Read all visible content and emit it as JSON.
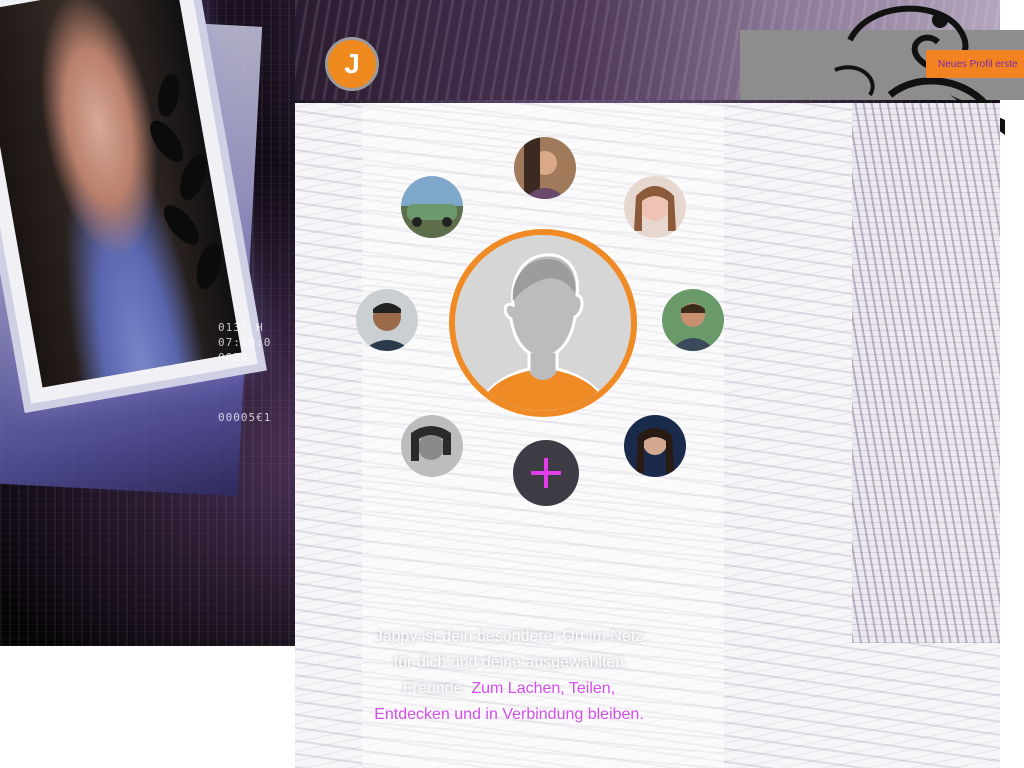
{
  "header": {
    "logo_letter": "J",
    "create_profile_label": "Neues Profil erste"
  },
  "friends_circle": {
    "main_avatar": "default-profile-silhouette",
    "add_button_icon": "plus-icon",
    "friends": [
      {
        "name": "friend-top"
      },
      {
        "name": "friend-top-left"
      },
      {
        "name": "friend-top-right"
      },
      {
        "name": "friend-left"
      },
      {
        "name": "friend-right"
      },
      {
        "name": "friend-bottom-left"
      },
      {
        "name": "friend-bottom-right"
      }
    ]
  },
  "tagline": {
    "text_plain": "Jappy ist dein besonderer Ort im Netz für dich und deine ausgewählten Freunde.",
    "text_highlight": "Zum Lachen, Teilen, Entdecken und in Verbindung bleiben."
  },
  "colors": {
    "accent_orange": "#ef8a24",
    "highlight_magenta": "#d24fe8",
    "add_button_bg": "#3d3c45"
  },
  "background_code": "0137 H\n07:10:0\n0024\n\n\n\n00005€1"
}
